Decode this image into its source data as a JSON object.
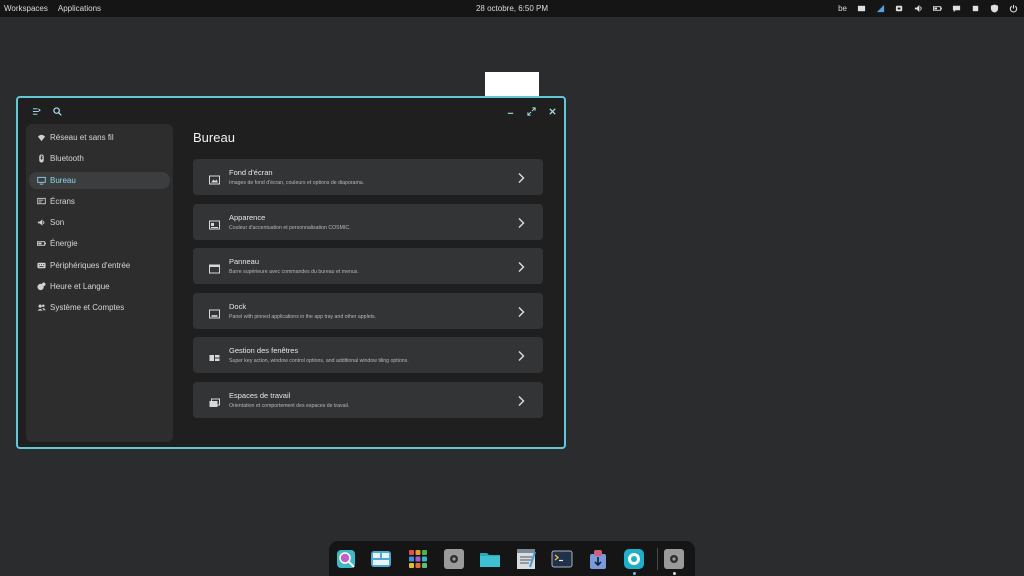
{
  "top_panel": {
    "left_items": [
      "Workspaces",
      "Applications"
    ],
    "clock": "28 octobre, 6:50 PM",
    "keyboard_layout": "be",
    "tray_icons": [
      "display-icon",
      "network-signal-icon",
      "notifications-icon",
      "volume-icon",
      "battery-icon",
      "chat-icon",
      "notification-bell-icon",
      "shield-icon",
      "power-icon"
    ]
  },
  "window": {
    "header_buttons": [
      "sidebar-toggle-icon",
      "search-icon",
      "minimize-icon",
      "maximize-icon",
      "close-icon"
    ],
    "sidebar": [
      {
        "label": "Réseau et sans fil",
        "icon": "wifi-icon",
        "active": false
      },
      {
        "label": "Bluetooth",
        "icon": "bluetooth-icon",
        "active": false
      },
      {
        "label": "Bureau",
        "icon": "desktop-icon",
        "active": true
      },
      {
        "label": "Écrans",
        "icon": "displays-icon",
        "active": false
      },
      {
        "label": "Son",
        "icon": "sound-icon",
        "active": false
      },
      {
        "label": "Énergie",
        "icon": "battery-icon",
        "active": false
      },
      {
        "label": "Périphériques d'entrée",
        "icon": "keyboard-icon",
        "active": false
      },
      {
        "label": "Heure et Langue",
        "icon": "clock-language-icon",
        "active": false
      },
      {
        "label": "Système et Comptes",
        "icon": "users-icon",
        "active": false
      }
    ],
    "page_title": "Bureau",
    "cards": [
      {
        "title": "Fond d'écran",
        "subtitle": "Images de fond d'écran, couleurs et options de diaporama.",
        "icon": "wallpaper-icon"
      },
      {
        "title": "Apparence",
        "subtitle": "Couleur d'accentuation et personnalisation COSMIC.",
        "icon": "appearance-icon"
      },
      {
        "title": "Panneau",
        "subtitle": "Barre supérieure avec commandes du bureau et menus.",
        "icon": "panel-icon"
      },
      {
        "title": "Dock",
        "subtitle": "Panel with pinned applications in the app tray and other applets.",
        "icon": "dock-icon"
      },
      {
        "title": "Gestion des fenêtres",
        "subtitle": "Super key action, window control options, and additional window tiling options.",
        "icon": "window-management-icon"
      },
      {
        "title": "Espaces de travail",
        "subtitle": "Orientation et comportement des espaces de travail.",
        "icon": "workspaces-icon"
      }
    ]
  },
  "dock": {
    "apps": [
      {
        "name": "launcher-icon",
        "color": "#3fb8c8"
      },
      {
        "name": "workspaces-overview-icon",
        "color": "#4fa8d8"
      },
      {
        "name": "app-library-icon",
        "color": "#e0a030"
      },
      {
        "name": "settings-icon",
        "color": "#9a9a9a"
      },
      {
        "name": "files-icon",
        "color": "#2fa6b8"
      },
      {
        "name": "text-editor-icon",
        "color": "#b8c0c8"
      },
      {
        "name": "terminal-icon",
        "color": "#20324a"
      },
      {
        "name": "store-icon",
        "color": "#7a9ad8"
      },
      {
        "name": "cosmic-settings-icon",
        "color": "#1fb0c8"
      },
      {
        "name": "settings-running-icon",
        "color": "#9a9a9a"
      }
    ]
  },
  "colors": {
    "accent": "#63c7d8",
    "window_bg": "#1f1f1f",
    "card_bg": "#333436",
    "desktop_bg": "#2b2c2e"
  }
}
